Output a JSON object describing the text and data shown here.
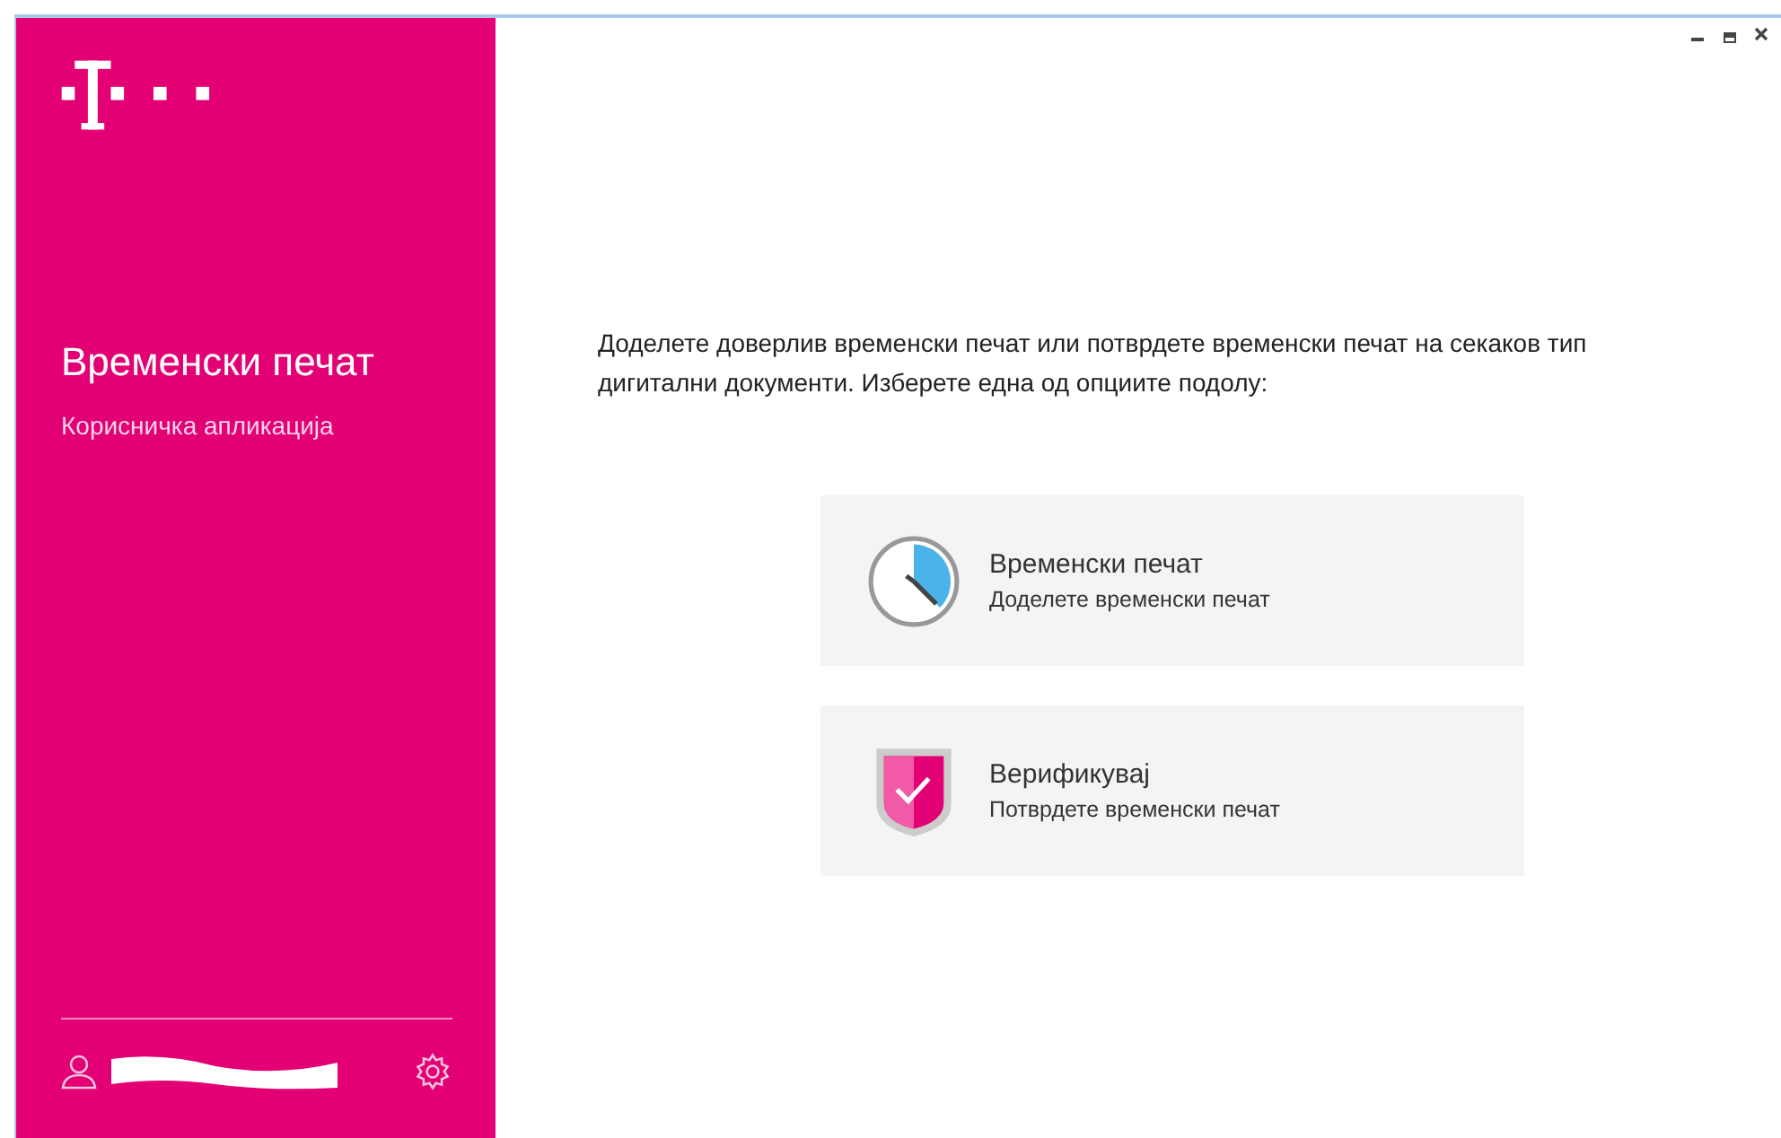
{
  "sidebar": {
    "title": "Временски печат",
    "subtitle": "Корисничка апликација"
  },
  "intro": "Доделете доверлив временски печат или потврдете временски печат на секаков тип дигитални документи. Изберете една од опциите подолу:",
  "options": [
    {
      "kind": "clock",
      "title": "Временски печат",
      "subtitle": "Доделете временски печат"
    },
    {
      "kind": "shield",
      "title": "Верификувај",
      "subtitle": "Потврдете временски печат"
    }
  ]
}
